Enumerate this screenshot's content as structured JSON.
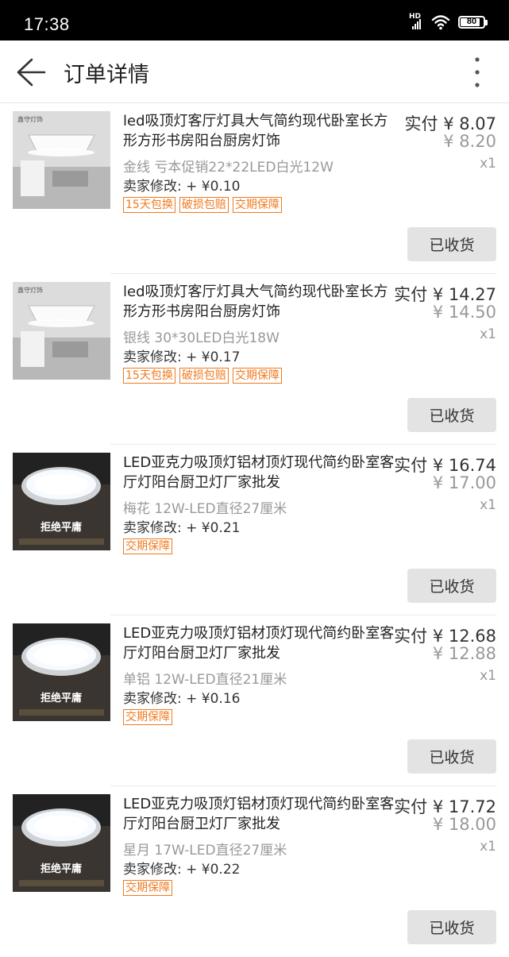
{
  "status_bar": {
    "time": "17:38",
    "network": "HD",
    "battery": "80"
  },
  "header": {
    "title": "订单详情"
  },
  "items": [
    {
      "title": "led吸顶灯客厅灯具大气简约现代卧室长方形方形书房阳台厨房灯饰",
      "spec": "金线 亏本促销22*22LED白光12W",
      "modify": "卖家修改: + ¥0.10",
      "paid": "实付 ¥ 8.07",
      "original": "¥ 8.20",
      "qty": "x1",
      "tags": [
        "15天包换",
        "破损包赔",
        "交期保障"
      ],
      "thumb_text": "鑫守灯饰",
      "button": "已收货"
    },
    {
      "title": "led吸顶灯客厅灯具大气简约现代卧室长方形方形书房阳台厨房灯饰",
      "spec": "银线 30*30LED白光18W",
      "modify": "卖家修改: + ¥0.17",
      "paid": "实付 ¥ 14.27",
      "original": "¥ 14.50",
      "qty": "x1",
      "tags": [
        "15天包换",
        "破损包赔",
        "交期保障"
      ],
      "thumb_text": "鑫守灯饰",
      "button": "已收货"
    },
    {
      "title": "LED亚克力吸顶灯铝材顶灯现代简约卧室客厅灯阳台厨卫灯厂家批发",
      "spec": "梅花 12W-LED直径27厘米",
      "modify": "卖家修改: + ¥0.21",
      "paid": "实付 ¥ 16.74",
      "original": "¥ 17.00",
      "qty": "x1",
      "tags": [
        "交期保障"
      ],
      "thumb_text": "拒绝平庸",
      "button": "已收货"
    },
    {
      "title": "LED亚克力吸顶灯铝材顶灯现代简约卧室客厅灯阳台厨卫灯厂家批发",
      "spec": "单铝 12W-LED直径21厘米",
      "modify": "卖家修改: + ¥0.16",
      "paid": "实付 ¥ 12.68",
      "original": "¥ 12.88",
      "qty": "x1",
      "tags": [
        "交期保障"
      ],
      "thumb_text": "拒绝平庸",
      "button": "已收货"
    },
    {
      "title": "LED亚克力吸顶灯铝材顶灯现代简约卧室客厅灯阳台厨卫灯厂家批发",
      "spec": "星月 17W-LED直径27厘米",
      "modify": "卖家修改: + ¥0.22",
      "paid": "实付 ¥ 17.72",
      "original": "¥ 18.00",
      "qty": "x1",
      "tags": [
        "交期保障"
      ],
      "thumb_text": "拒绝平庸",
      "button": "已收货"
    }
  ]
}
